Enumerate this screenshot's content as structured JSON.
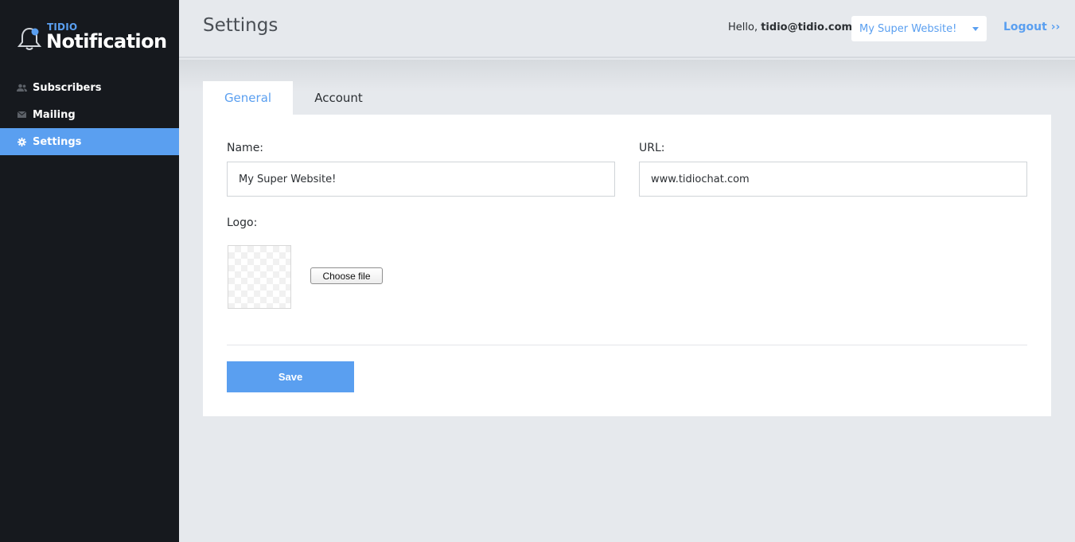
{
  "brand": {
    "small": "TIDIO",
    "big": "Notification",
    "icon": "bell-icon"
  },
  "sidebar": {
    "items": [
      {
        "label": "Subscribers",
        "icon": "users-icon",
        "active": false
      },
      {
        "label": "Mailing",
        "icon": "envelope-icon",
        "active": false
      },
      {
        "label": "Settings",
        "icon": "gear-icon",
        "active": true
      }
    ]
  },
  "header": {
    "title": "Settings",
    "hello_prefix": "Hello, ",
    "user_email": "tidio@tidio.com",
    "site_select_value": "My Super Website!",
    "logout_label": "Logout ››"
  },
  "tabs": [
    {
      "label": "General",
      "active": true
    },
    {
      "label": "Account",
      "active": false
    }
  ],
  "form": {
    "name_label": "Name:",
    "name_value": "My Super Website!",
    "url_label": "URL:",
    "url_value": "www.tidiochat.com",
    "logo_label": "Logo:",
    "choose_file_label": "Choose file",
    "save_label": "Save"
  },
  "colors": {
    "accent": "#5a9ff0",
    "sidebar_bg": "#16191e",
    "page_bg": "#e6e9ed"
  }
}
